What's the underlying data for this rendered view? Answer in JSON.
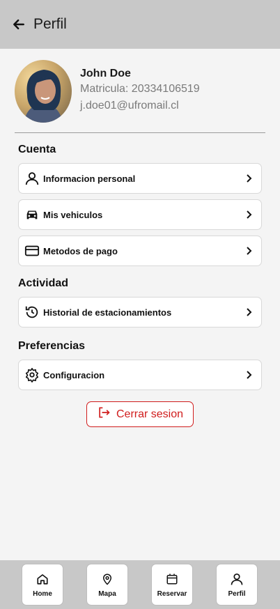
{
  "header": {
    "title": "Perfil",
    "back_icon": "arrow-left-icon"
  },
  "profile": {
    "name": "John Doe",
    "matricula": "Matricula: 20334106519",
    "email": "j.doe01@ufromail.cl"
  },
  "sections": {
    "cuenta": "Cuenta",
    "actividad": "Actividad",
    "preferencias": "Preferencias"
  },
  "items": {
    "personal": {
      "label": "Informacion personal",
      "icon": "user-icon"
    },
    "vehicles": {
      "label": "Mis vehiculos",
      "icon": "car-icon"
    },
    "payment": {
      "label": "Metodos de pago",
      "icon": "credit-card-icon"
    },
    "history": {
      "label": "Historial de estacionamientos",
      "icon": "history-icon"
    },
    "settings": {
      "label": "Configuracion",
      "icon": "gear-icon"
    }
  },
  "logout": {
    "label": "Cerrar sesion",
    "icon": "logout-icon",
    "color": "#d01c1c"
  },
  "bottom_nav": [
    {
      "label": "Home",
      "icon": "home-icon"
    },
    {
      "label": "Mapa",
      "icon": "map-pin-icon"
    },
    {
      "label": "Reservar",
      "icon": "calendar-icon"
    },
    {
      "label": "Perfil",
      "icon": "user-icon"
    }
  ]
}
